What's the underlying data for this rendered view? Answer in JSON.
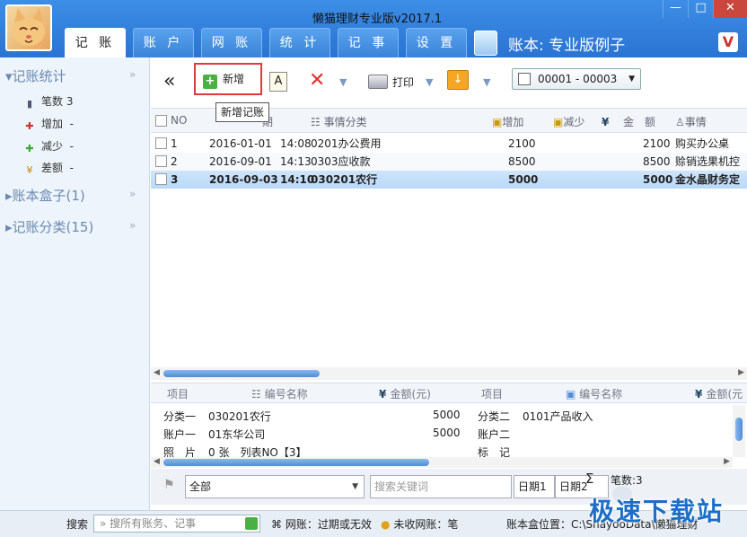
{
  "window": {
    "title": "懒猫理财专业版v2017.1",
    "ledger_label": "账本: 专业版例子",
    "min": "—",
    "max": "□",
    "close": "✕"
  },
  "tabs": [
    "记 账",
    "账 户",
    "网 账",
    "统 计",
    "记 事",
    "设 置"
  ],
  "sidebar": {
    "section1": "记账统计",
    "items": [
      {
        "label": "笔数",
        "value": "3"
      },
      {
        "label": "增加",
        "value": "-"
      },
      {
        "label": "减少",
        "value": "-"
      },
      {
        "label": "差额",
        "value": "-"
      }
    ],
    "section2": "账本盒子(1)",
    "section3": "记账分类(15)",
    "chevron": "»"
  },
  "toolbar": {
    "back": "«",
    "new": "新增",
    "print": "打印",
    "range": "00001 - 00003",
    "tooltip": "新增记账"
  },
  "grid": {
    "headers": {
      "no": "NO",
      "date": "期",
      "category": "事情分类",
      "increase": "增加",
      "decrease": "减少",
      "amount": "金　额",
      "matter": "事情"
    },
    "rows": [
      {
        "no": "1",
        "date": "2016-01-01",
        "time": "14:08",
        "category": "0201办公费用",
        "increase": "2100",
        "amount": "2100",
        "matter": "购买办公桌"
      },
      {
        "no": "2",
        "date": "2016-09-01",
        "time": "14:13",
        "category": "0303应收款",
        "increase": "8500",
        "amount": "8500",
        "matter": "赊销选果机控"
      },
      {
        "no": "3",
        "date": "2016-09-03",
        "time": "14:10",
        "category": "030201农行",
        "increase": "5000",
        "amount": "5000",
        "matter": "金水晶财务定"
      }
    ]
  },
  "detail": {
    "headers": {
      "item": "项目",
      "code_name": "编号名称",
      "amount": "金额(元)",
      "item2": "项目",
      "code_name2": "编号名称",
      "amount2": "金额(元"
    },
    "left": [
      {
        "label": "分类一",
        "value": "030201农行",
        "amount": "5000"
      },
      {
        "label": "账户一",
        "value": "01东华公司",
        "amount": "5000"
      },
      {
        "label": "照　片",
        "value": "0 张　列表NO【3】",
        "amount": ""
      }
    ],
    "right": [
      {
        "label": "分类二",
        "value": "0101产品收入"
      },
      {
        "label": "账户二",
        "value": ""
      },
      {
        "label": "标　记",
        "value": ""
      }
    ]
  },
  "filter": {
    "scope": "全部",
    "keyword_placeholder": "搜索关键词",
    "date1": "日期1",
    "date2": "日期2",
    "count": "笔数:3",
    "sigma": "Σ"
  },
  "status": {
    "search_label": "搜索",
    "search_placeholder": "搜所有账务、记事",
    "net_account": "网账：过期或无效",
    "unreceived": "未收网账：",
    "unreceived_value": "笔",
    "location_label": "账本盒位置：",
    "location_value": "C:\\ShayooData\\懒猫理财"
  },
  "watermark": "极速下载站"
}
